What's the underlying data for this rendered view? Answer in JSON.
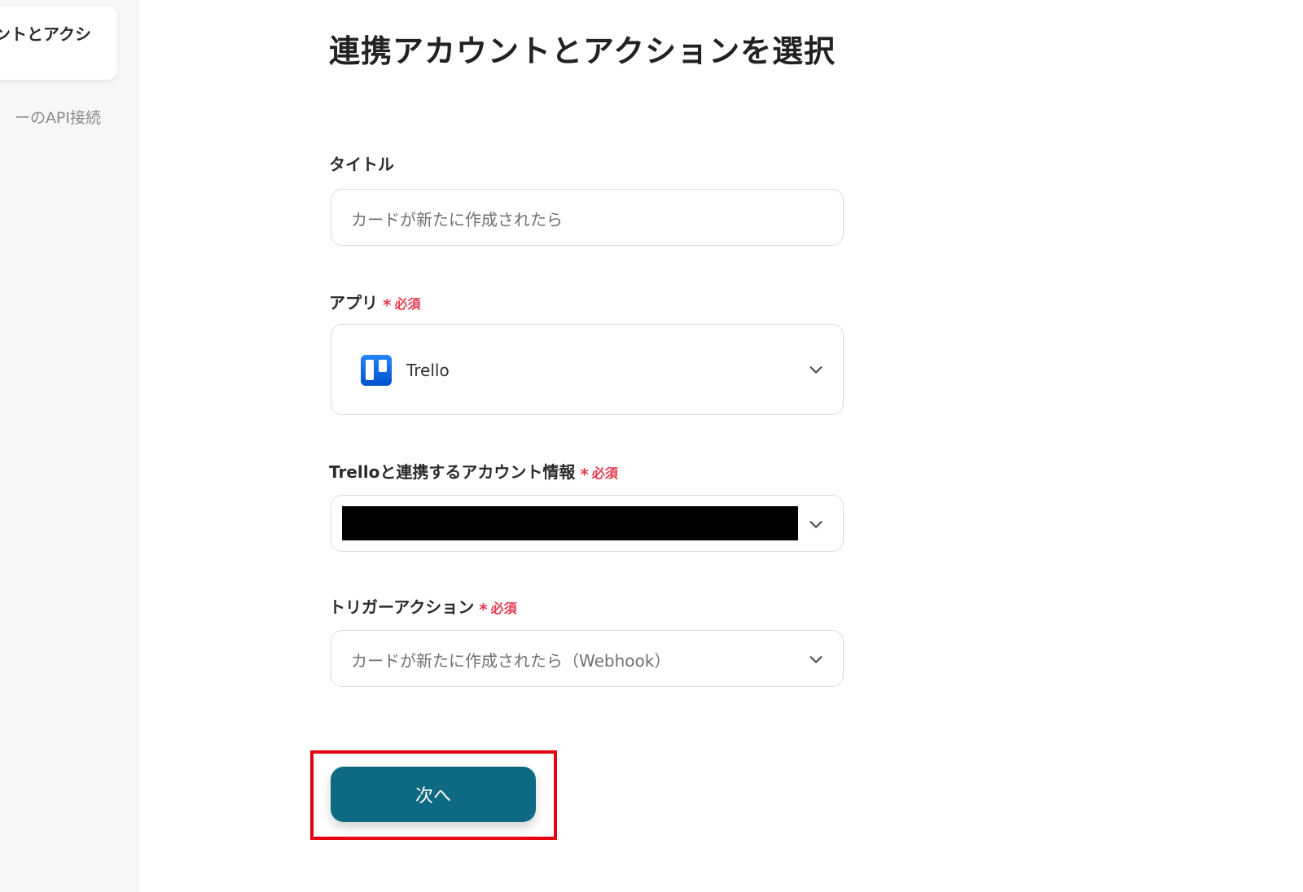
{
  "sidebar": {
    "active_step_label": "ントとアクシ",
    "next_step_label": "ーのAPI接続"
  },
  "page": {
    "title": "連携アカウントとアクションを選択"
  },
  "form": {
    "title_field": {
      "label": "タイトル",
      "value": "カードが新たに作成されたら"
    },
    "app_field": {
      "label": "アプリ",
      "required": "必須",
      "required_mark": "*",
      "value": "Trello",
      "icon": "trello-logo"
    },
    "account_field": {
      "label": "Trelloと連携するアカウント情報",
      "required": "必須",
      "required_mark": "*"
    },
    "trigger_field": {
      "label": "トリガーアクション",
      "required": "必須",
      "required_mark": "*",
      "value": "カードが新たに作成されたら（Webhook）"
    }
  },
  "actions": {
    "next_label": "次へ"
  },
  "colors": {
    "primary": "#0e6a82",
    "required": "#e5394f",
    "highlight": "#e60012"
  }
}
